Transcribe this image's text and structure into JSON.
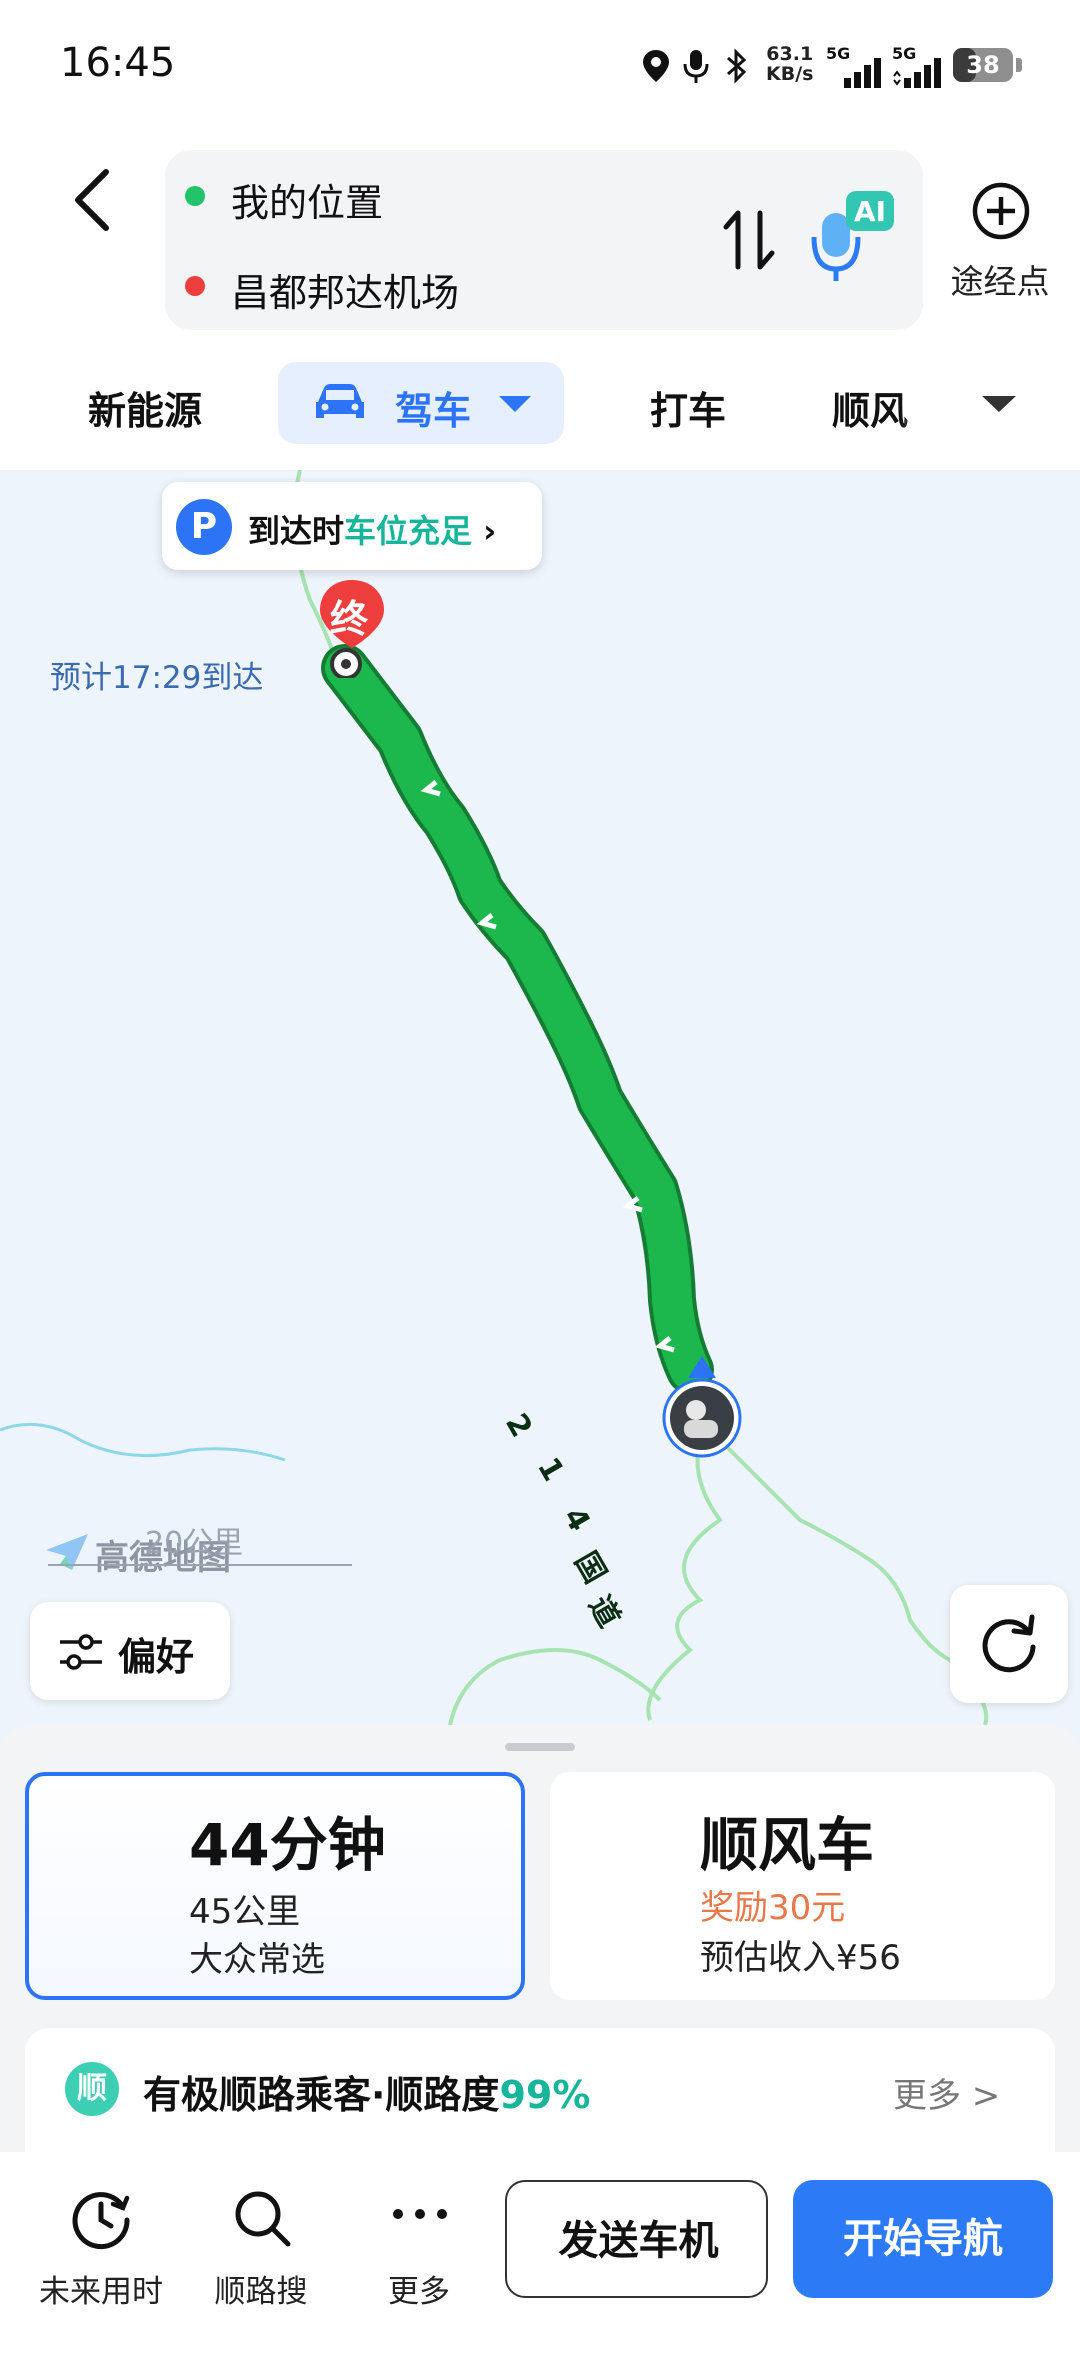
{
  "status_bar": {
    "time": "16:45",
    "net_speed_value": "63.1",
    "net_speed_unit": "KB/s",
    "signal1_label": "5G",
    "signal2_label": "5G",
    "battery": "38",
    "battery_level": 0.38
  },
  "header": {
    "origin": "我的位置",
    "destination": "昌都邦达机场",
    "ai_badge": "AI",
    "waypoint_label": "途经点"
  },
  "mode_tabs": {
    "tabs": [
      "新能源",
      "驾车",
      "打车",
      "顺风车"
    ],
    "selected": "驾车",
    "tab3_visible": "顺风"
  },
  "map": {
    "parking_prefix": "到达时",
    "parking_highlight": "车位充足",
    "parking_icon": "P",
    "eta": "预计17:29到达",
    "end_marker": "终",
    "road_chars": [
      "2",
      "1",
      "4",
      "国",
      "道"
    ],
    "scale": "20公里",
    "watermark": "高德地图",
    "preference_label": "偏好"
  },
  "route_cards": {
    "drive": {
      "duration": "44分钟",
      "distance": "45公里",
      "tag": "大众常选"
    },
    "rideshare": {
      "title": "顺风车",
      "reward": "奖励30元",
      "income": "预估收入¥56"
    }
  },
  "hint": {
    "badge": "顺",
    "text": "有极顺路乘客·顺路度",
    "pct": "99%",
    "more": "更多 >"
  },
  "bottom_bar": {
    "future_time": "未来用时",
    "search_along": "顺路搜",
    "more": "更多",
    "send_to_car": "发送车机",
    "start_nav": "开始导航"
  },
  "colors": {
    "accent": "#2c74f5",
    "route_green": "#1db84d",
    "teal": "#17b59a",
    "reward_orange": "#e9774a"
  }
}
